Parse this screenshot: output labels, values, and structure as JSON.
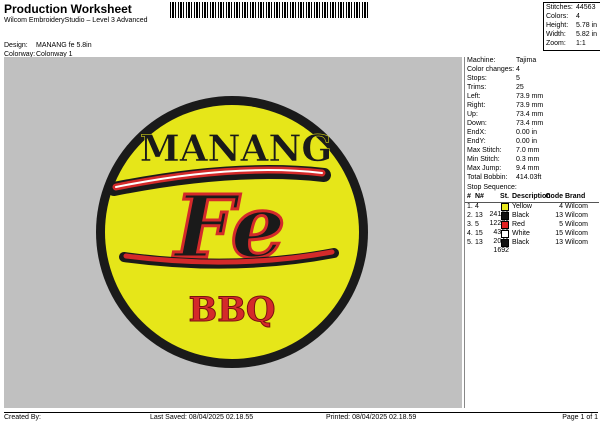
{
  "header": {
    "title": "Production Worksheet",
    "subtitle": "Wilcom EmbroideryStudio – Level 3 Advanced",
    "design_label": "Design:",
    "design_value": "MANANG fe 5.8in",
    "colorway_label": "Colorway:",
    "colorway_value": "Colonway 1"
  },
  "stats": [
    {
      "label": "Stitches:",
      "value": "44563"
    },
    {
      "label": "Colors:",
      "value": "4"
    },
    {
      "label": "Height:",
      "value": "5.78 in"
    },
    {
      "label": "Width:",
      "value": "5.82 in"
    },
    {
      "label": "Zoom:",
      "value": "1:1"
    }
  ],
  "specs": [
    {
      "label": "Machine:",
      "value": "Tajima"
    },
    {
      "label": "Color changes:",
      "value": "4"
    },
    {
      "label": "Stops:",
      "value": "5"
    },
    {
      "label": "Trims:",
      "value": "25"
    },
    {
      "label": "Left:",
      "value": "73.9 mm"
    },
    {
      "label": "Right:",
      "value": "73.9 mm"
    },
    {
      "label": "Up:",
      "value": "73.4 mm"
    },
    {
      "label": "Down:",
      "value": "73.4 mm"
    },
    {
      "label": "EndX:",
      "value": "0.00 in"
    },
    {
      "label": "EndY:",
      "value": "0.00 in"
    },
    {
      "label": "Max Stitch:",
      "value": "7.0 mm"
    },
    {
      "label": "Min Stitch:",
      "value": "0.3 mm"
    },
    {
      "label": "Max Jump:",
      "value": "9.4 mm"
    },
    {
      "label": "Total Bobbin:",
      "value": "414.03ft"
    }
  ],
  "sequence": {
    "heading": "Stop Sequence:",
    "columns": [
      "#",
      "N#",
      "St.",
      "Description",
      "Code",
      "Brand"
    ],
    "rows": [
      {
        "num": "1.",
        "n": "4",
        "color": "#e8e81c",
        "st": "24189",
        "desc": "Yellow",
        "code": "4",
        "brand": "Wilcom"
      },
      {
        "num": "2.",
        "n": "13",
        "color": "#111111",
        "st": "12270",
        "desc": "Black",
        "code": "13",
        "brand": "Wilcom"
      },
      {
        "num": "3.",
        "n": "5",
        "color": "#e02020",
        "st": "4369",
        "desc": "Red",
        "code": "5",
        "brand": "Wilcom"
      },
      {
        "num": "4.",
        "n": "15",
        "color": "#ffffff",
        "st": "2041",
        "desc": "White",
        "code": "15",
        "brand": "Wilcom"
      },
      {
        "num": "5.",
        "n": "13",
        "color": "#111111",
        "st": "1692",
        "desc": "Black",
        "code": "13",
        "brand": "Wilcom"
      }
    ]
  },
  "design": {
    "line1": "MANANG",
    "line2": "Fe",
    "line3": "BBQ",
    "colors": {
      "yellow": "#e6e619",
      "black": "#1a1a1a",
      "red": "#d42a2a",
      "white": "#ffffff",
      "canvas": "#c0c0c0"
    }
  },
  "footer": {
    "created": "Created By:",
    "saved": "Last Saved: 08/04/2025 02.18.55",
    "printed": "Printed: 08/04/2025 02.18.59",
    "page": "Page 1 of 1"
  }
}
